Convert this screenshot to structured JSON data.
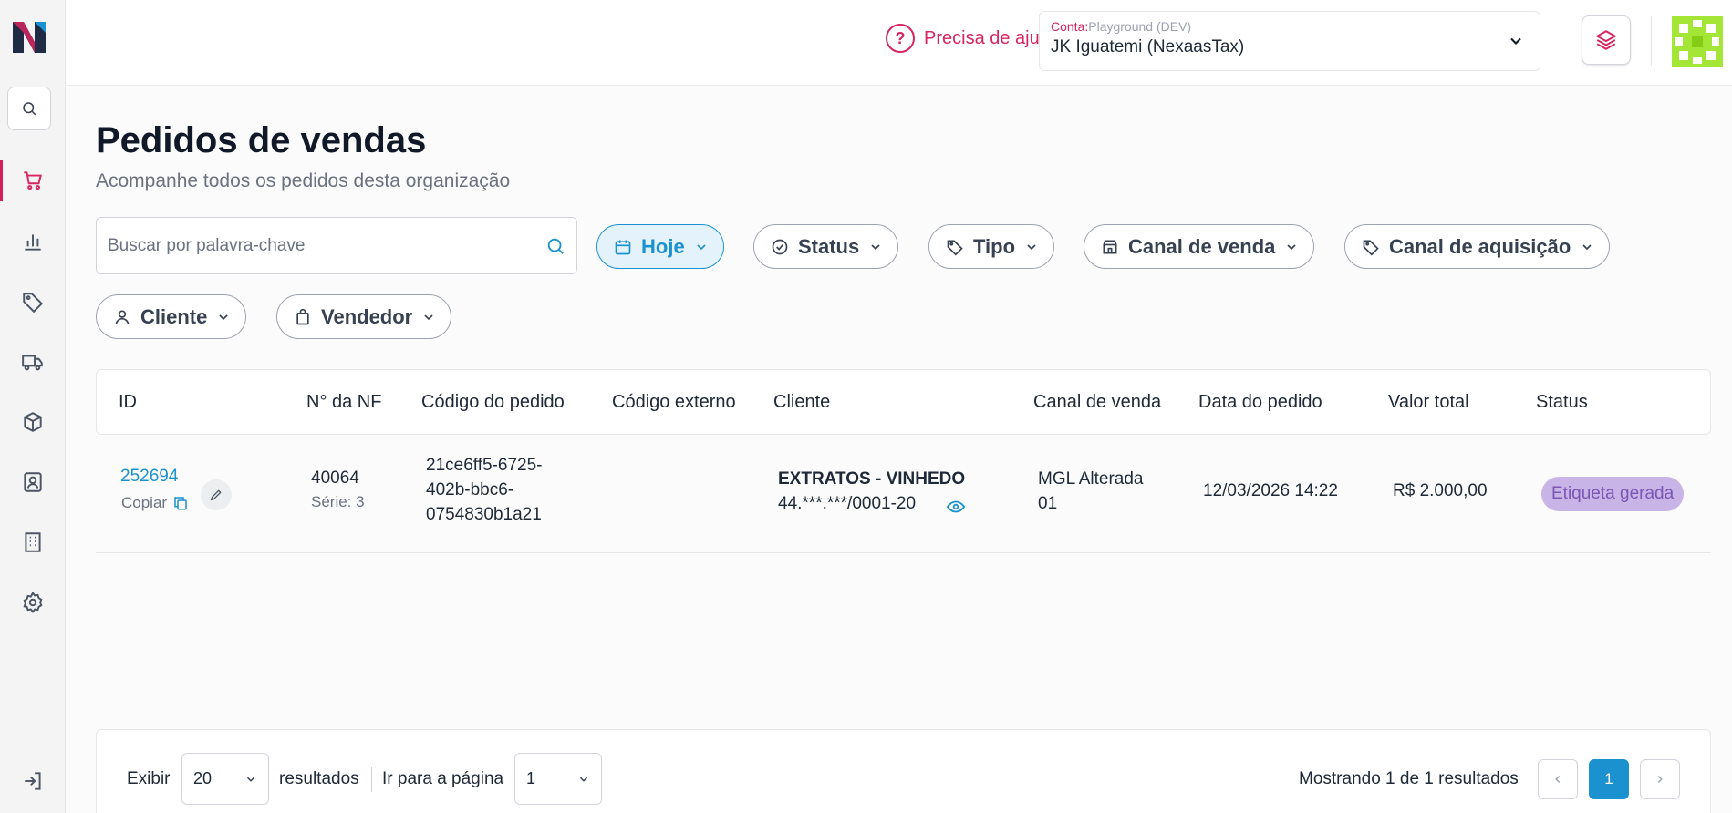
{
  "header": {
    "help_text": "Precisa de ajuda?",
    "account_label_prefix": "Conta:",
    "account_env": "Playground (DEV)",
    "account_name": "JK Iguatemi (NexaasTax)"
  },
  "page": {
    "title": "Pedidos de vendas",
    "subtitle": "Acompanhe todos os pedidos desta organização"
  },
  "search": {
    "placeholder": "Buscar por palavra-chave"
  },
  "filters": {
    "date": "Hoje",
    "status": "Status",
    "tipo": "Tipo",
    "canal_venda": "Canal de venda",
    "canal_aquisicao": "Canal de aquisição",
    "cliente": "Cliente",
    "vendedor": "Vendedor"
  },
  "table": {
    "columns": {
      "id": "ID",
      "nf": "N° da NF",
      "codigo_pedido": "Código do pedido",
      "codigo_externo": "Código externo",
      "cliente": "Cliente",
      "canal": "Canal de venda",
      "data": "Data do pedido",
      "valor": "Valor total",
      "status": "Status"
    },
    "rows": [
      {
        "id": "252694",
        "copy_label": "Copiar",
        "nf": "40064",
        "serie": "Série: 3",
        "codigo_l1": "21ce6ff5-6725-",
        "codigo_l2": "402b-bbc6-",
        "codigo_l3": "0754830b1a21",
        "codigo_externo": "",
        "cliente_nome": "EXTRATOS - VINHEDO",
        "cliente_doc": "44.***.***/0001-20",
        "canal_l1": "MGL Alterada",
        "canal_l2": "01",
        "data": "12/03/2026 14:22",
        "valor": "R$ 2.000,00",
        "status": "Etiqueta gerada"
      }
    ]
  },
  "footer": {
    "exibir": "Exibir",
    "per_page": "20",
    "resultados": "resultados",
    "ir_para": "Ir para a página",
    "page_select": "1",
    "showing": "Mostrando 1 de 1 resultados",
    "current_page": "1"
  },
  "colors": {
    "brand": "#d6255f",
    "accent": "#1b92cf",
    "status_badge_bg": "#c8b4e6",
    "status_badge_text": "#7b56b5"
  }
}
